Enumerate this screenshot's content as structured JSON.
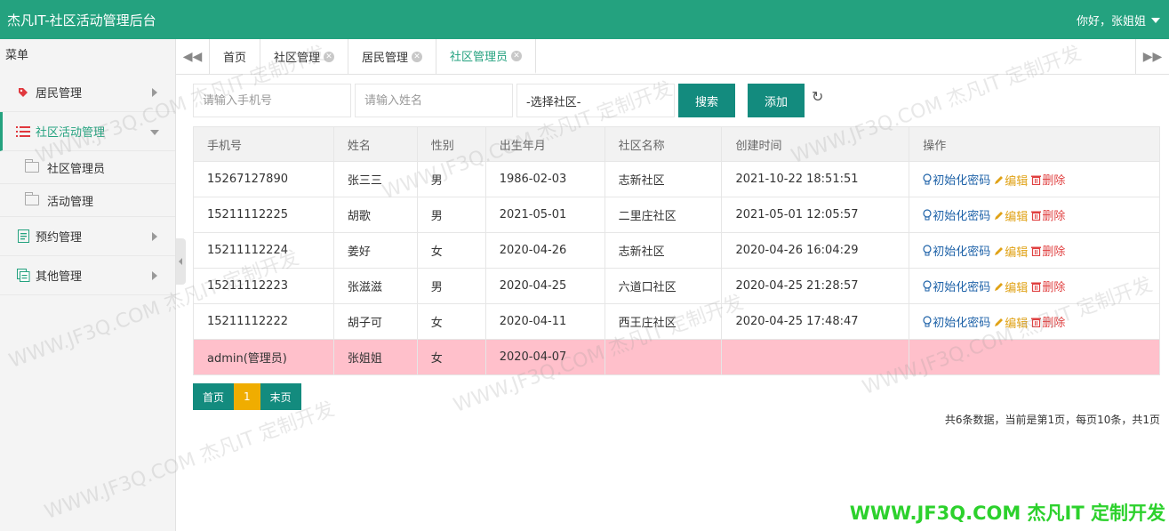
{
  "header": {
    "app_title": "杰凡IT-社区活动管理后台",
    "user_greeting": "你好，张姐姐"
  },
  "sidebar": {
    "menu_label": "菜单",
    "items": [
      {
        "label": "居民管理",
        "icon": "tag-icon"
      },
      {
        "label": "社区活动管理",
        "icon": "list-icon",
        "expanded": true,
        "children": [
          {
            "label": "社区管理员"
          },
          {
            "label": "活动管理"
          }
        ]
      },
      {
        "label": "预约管理",
        "icon": "document-icon"
      },
      {
        "label": "其他管理",
        "icon": "copy-icon"
      }
    ]
  },
  "tabs": [
    {
      "label": "首页",
      "closable": false
    },
    {
      "label": "社区管理",
      "closable": true
    },
    {
      "label": "居民管理",
      "closable": true
    },
    {
      "label": "社区管理员",
      "closable": true,
      "active": true
    }
  ],
  "toolbar": {
    "phone_placeholder": "请输入手机号",
    "name_placeholder": "请输入姓名",
    "community_select": "-选择社区-",
    "search_label": "搜索",
    "add_label": "添加"
  },
  "table": {
    "columns": [
      "手机号",
      "姓名",
      "性别",
      "出生年月",
      "社区名称",
      "创建时间",
      "操作"
    ],
    "actions": {
      "reset": "初始化密码",
      "edit": "编辑",
      "delete": "删除"
    },
    "rows": [
      {
        "phone": "15267127890",
        "name": "张三三",
        "gender": "男",
        "birth": "1986-02-03",
        "community": "志新社区",
        "created": "2021-10-22 18:51:51"
      },
      {
        "phone": "15211112225",
        "name": "胡歌",
        "gender": "男",
        "birth": "2021-05-01",
        "community": "二里庄社区",
        "created": "2021-05-01 12:05:57"
      },
      {
        "phone": "15211112224",
        "name": "姜好",
        "gender": "女",
        "birth": "2020-04-26",
        "community": "志新社区",
        "created": "2020-04-26 16:04:29"
      },
      {
        "phone": "15211112223",
        "name": "张滋滋",
        "gender": "男",
        "birth": "2020-04-25",
        "community": "六道口社区",
        "created": "2020-04-25 21:28:57"
      },
      {
        "phone": "15211112222",
        "name": "胡子可",
        "gender": "女",
        "birth": "2020-04-11",
        "community": "西王庄社区",
        "created": "2020-04-25 17:48:47"
      }
    ],
    "admin_row": {
      "phone": "admin(管理员)",
      "name": "张姐姐",
      "gender": "女",
      "birth": "2020-04-07",
      "community": "",
      "created": ""
    }
  },
  "pager": {
    "first": "首页",
    "current": "1",
    "last": "末页",
    "summary": "共6条数据，当前是第1页，每页10条，共1页"
  },
  "watermark": {
    "text": "WWW.JF3Q.COM 杰凡IT 定制开发",
    "brand": "WWW.JF3Q.COM 杰凡IT  定制开发"
  },
  "colors": {
    "header": "#24a27f",
    "button": "#138b7e",
    "pager_current": "#f0ad00",
    "admin_row": "#ffc0cb"
  }
}
